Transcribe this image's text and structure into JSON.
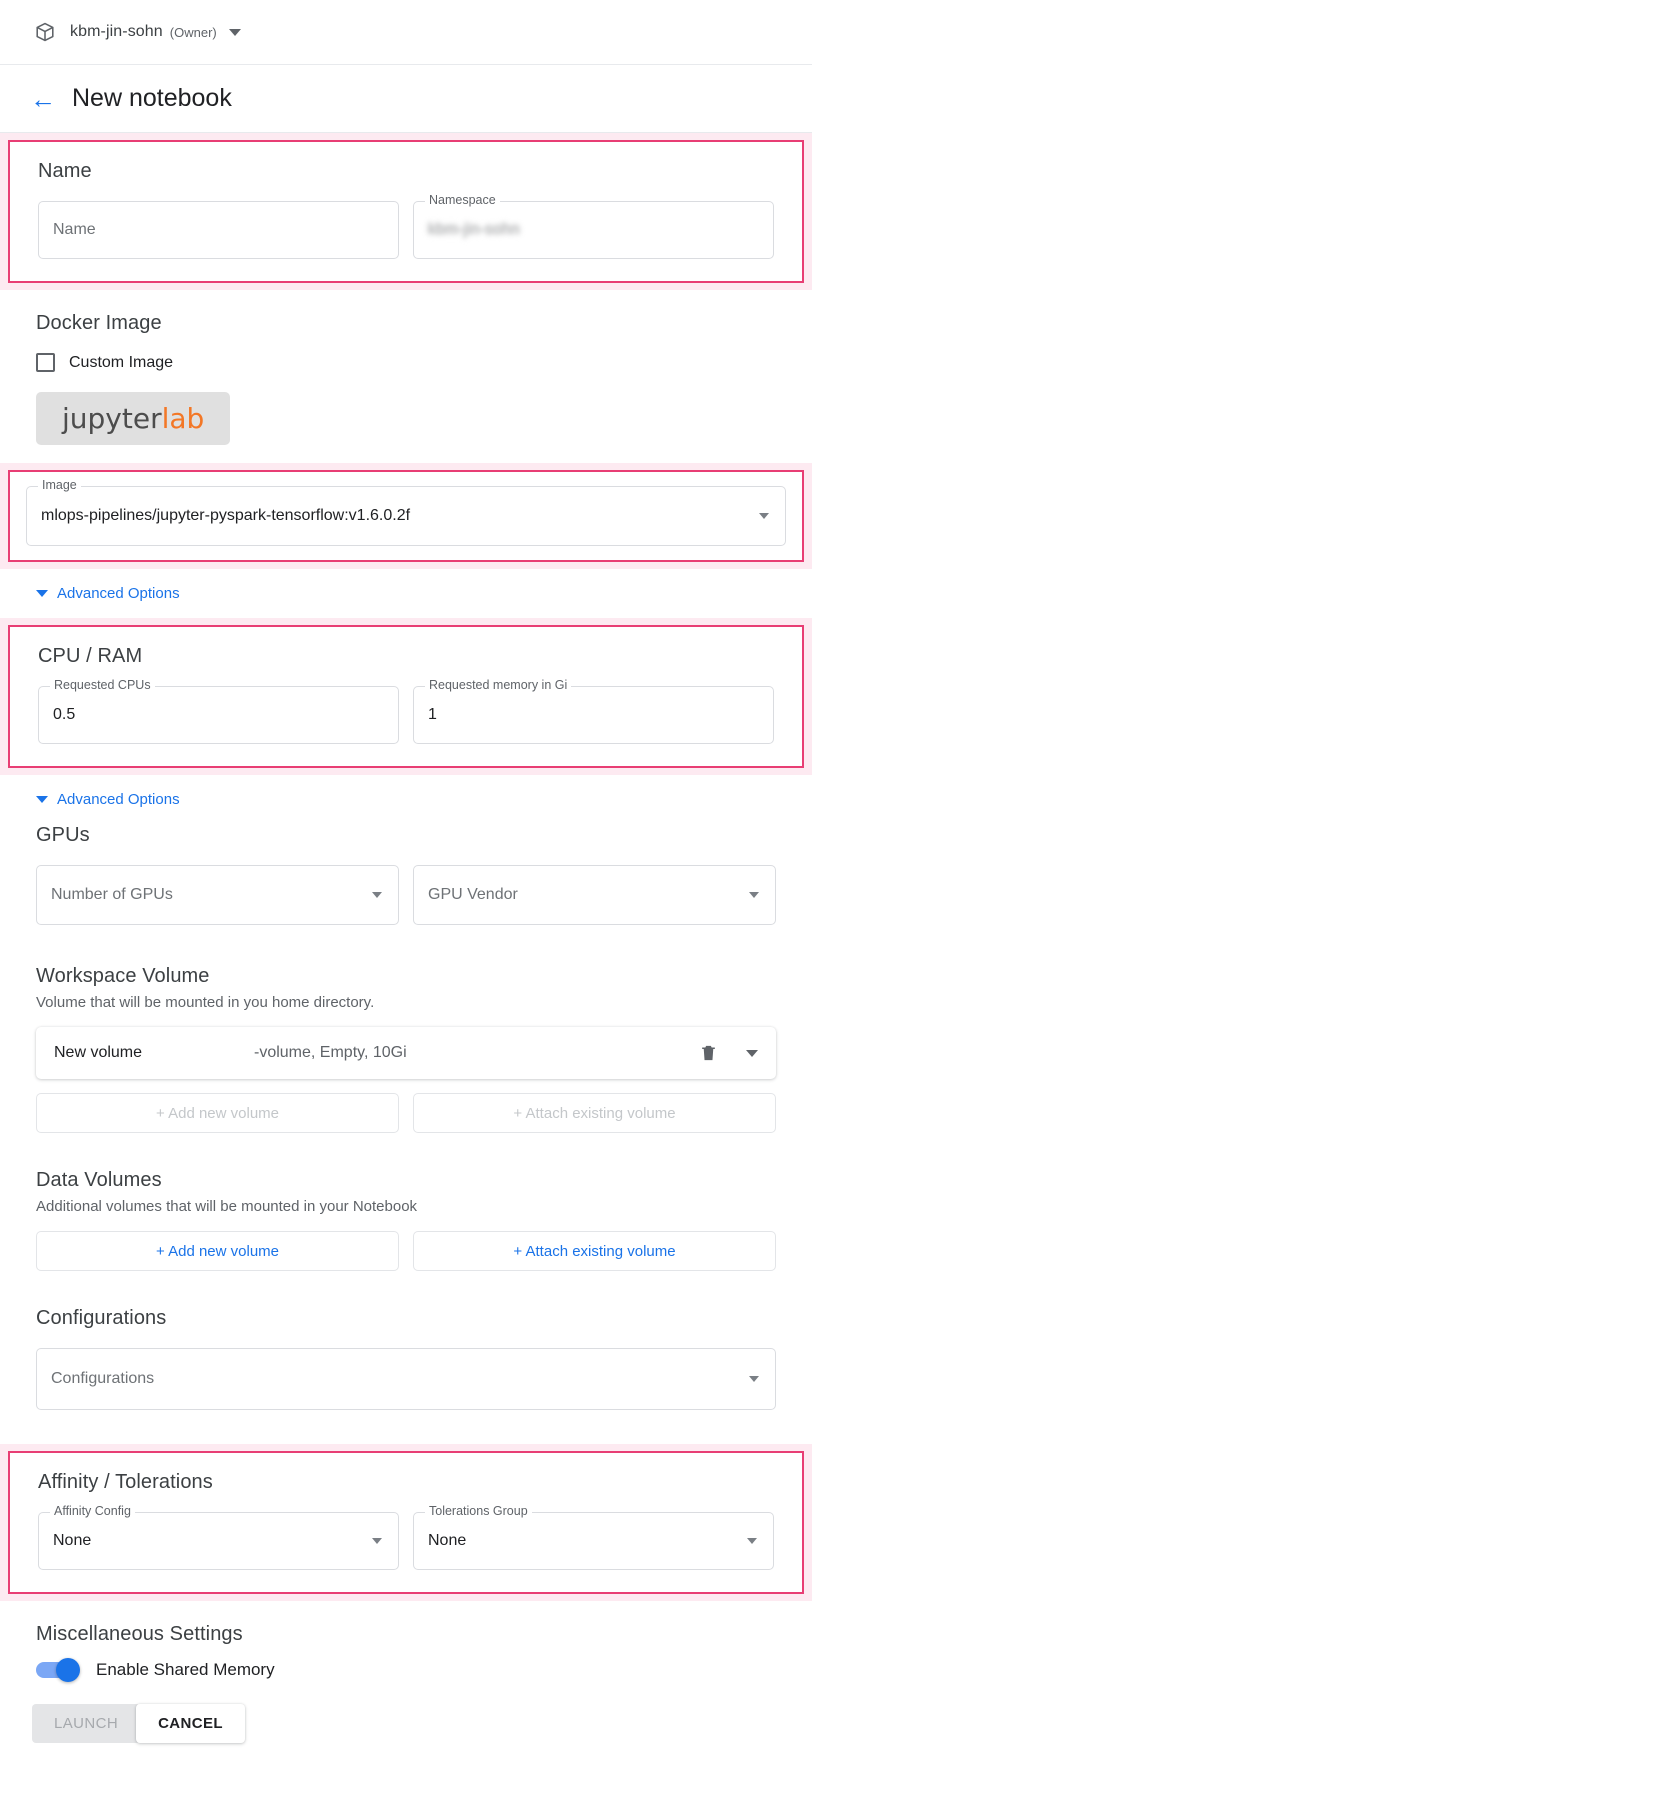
{
  "topbar": {
    "namespace": "kbm-jin-sohn",
    "role": "(Owner)",
    "icon": "cube-icon",
    "caret": "chevron-down-icon"
  },
  "header": {
    "back": "←",
    "title": "New notebook"
  },
  "sections": {
    "name": {
      "title": "Name",
      "highlighted": true,
      "name_field": {
        "placeholder": "Name",
        "value": ""
      },
      "namespace_field": {
        "legend": "Namespace",
        "value": "kbm-jin-sohn",
        "redacted": true
      }
    },
    "docker_image": {
      "title": "Docker Image",
      "custom_image_label": "Custom Image",
      "custom_image_checked": false,
      "logo": {
        "part1": "jupyter",
        "part2": "lab",
        "color1": "#4d4d4d",
        "color2": "#f37726"
      },
      "image_field": {
        "legend": "Image",
        "value": "mlops-pipelines/jupyter-pyspark-tensorflow:v1.6.0.2f",
        "highlighted": true
      }
    },
    "advanced_options_1": {
      "label": "Advanced Options"
    },
    "cpu_ram": {
      "title": "CPU / RAM",
      "highlighted": true,
      "cpu_field": {
        "legend": "Requested CPUs",
        "value": "0.5"
      },
      "memory_field": {
        "legend": "Requested memory in Gi",
        "value": "1"
      }
    },
    "advanced_options_2": {
      "label": "Advanced Options"
    },
    "gpus": {
      "title": "GPUs",
      "number_field": {
        "placeholder": "Number of GPUs"
      },
      "vendor_field": {
        "placeholder": "GPU Vendor"
      }
    },
    "workspace_volume": {
      "title": "Workspace Volume",
      "subtitle": "Volume that will be mounted in you home directory.",
      "volume": {
        "name": "New volume",
        "meta": "-volume, Empty, 10Gi",
        "delete_icon": "trash-icon",
        "expand_icon": "chevron-down-icon"
      },
      "add_new_label": "+ Add new volume",
      "attach_label": "+ Attach existing volume",
      "buttons_disabled": true
    },
    "data_volumes": {
      "title": "Data Volumes",
      "subtitle": "Additional volumes that will be mounted in your Notebook",
      "add_new_label": "+ Add new volume",
      "attach_label": "+ Attach existing volume",
      "buttons_disabled": false
    },
    "configurations": {
      "title": "Configurations",
      "field": {
        "placeholder": "Configurations"
      }
    },
    "affinity": {
      "title": "Affinity / Tolerations",
      "highlighted": true,
      "affinity_field": {
        "legend": "Affinity Config",
        "value": "None"
      },
      "tolerations_field": {
        "legend": "Tolerations Group",
        "value": "None"
      }
    },
    "misc": {
      "title": "Miscellaneous Settings",
      "shared_memory_label": "Enable Shared Memory",
      "shared_memory_on": true
    }
  },
  "footer": {
    "launch_label": "LAUNCH",
    "launch_disabled": true,
    "cancel_label": "CANCEL"
  },
  "colors": {
    "highlight_border": "#e83e74",
    "highlight_bg": "#fdeaf1",
    "accent_blue": "#1a73e8",
    "jupyter_orange": "#f37726"
  }
}
